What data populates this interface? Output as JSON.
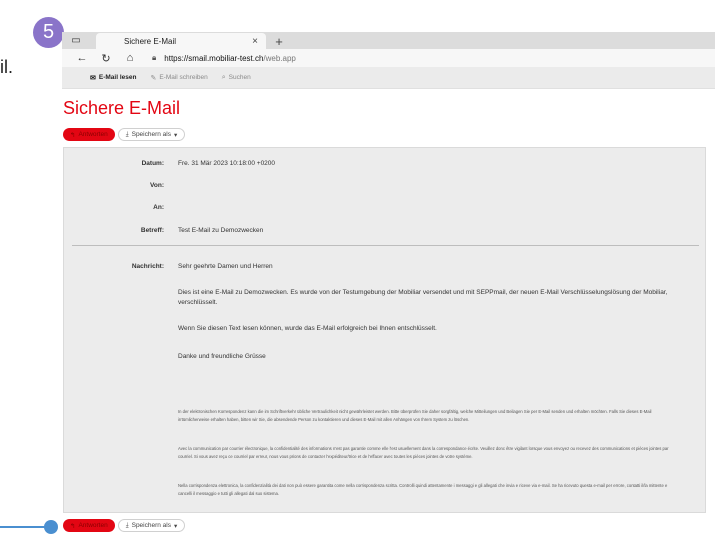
{
  "step_number": "5",
  "stray_text": "il.",
  "browser": {
    "tab_title": "Sichere E-Mail",
    "tab_close": "×",
    "new_tab": "+",
    "url_host": "https://smail.mobiliar-test.ch",
    "url_path": "/web.app"
  },
  "app_nav": {
    "items": [
      {
        "label": "E-Mail lesen",
        "icon": "envelope-icon",
        "active": true
      },
      {
        "label": "E-Mail schreiben",
        "icon": "pencil-icon",
        "active": false
      },
      {
        "label": "Suchen",
        "icon": "search-icon",
        "active": false
      }
    ]
  },
  "page_title": "Sichere E-Mail",
  "actions": {
    "reply_label": "Antworten",
    "save_label": "Speichern als",
    "save_caret": "▾"
  },
  "mail": {
    "date_label": "Datum:",
    "date_value": "Fre. 31 Mär 2023 10:18:00 +0200",
    "from_label": "Von:",
    "to_label": "An:",
    "subject_label": "Betreff:",
    "subject_value": "Test E-Mail zu Demozwecken",
    "message_label": "Nachricht:",
    "greeting": "Sehr geehrte Damen und Herren",
    "paragraph1": "Dies ist eine E-Mail zu Demozwecken. Es wurde von der Testumgebung der Mobiliar versendet und mit SEPPmail, der neuen E-Mail Verschlüsselungslösung der Mobiliar, verschlüsselt.",
    "paragraph2": "Wenn Sie diesen Text lesen können, wurde das E-Mail erfolgreich bei Ihnen entschlüsselt.",
    "closing": "Danke und freundliche Grüsse",
    "disclaimer_de": "In der elektronischen Korrespondenz kann die im Schriftverkehr übliche Vertraulichkeit nicht gewährleistet werden. Bitte überprüfen Sie daher sorgfältig, welche Mitteilungen und Beilagen Sie per E-Mail senden und erhalten möchten. Falls Sie dieses E-Mail irrtümlicherweise erhalten haben, bitten wir Sie, die absendende Person zu kontaktieren und dieses E-Mail mit allen Anhängen von Ihrem System zu löschen.",
    "disclaimer_fr": "Avec la communication par courrier électronique, la confidentialité des informations n'est pas garantie comme elle l'est usuellement dans la correspondance écrite. Veuillez donc être vigilant lorsque vous envoyez ou recevez des communications et pièces jointes par courriel. Si vous avez reçu ce courriel par erreur, nous vous prions de contacter l'expéditeur/trice et de l'effacer avec toutes les pièces jointes de votre système.",
    "disclaimer_it": "Nella corrispondenza elettronica, la confidenzialità dei dati non può essere garantita come nella corrispondenza scritta. Controlli quindi attentamente i messaggi e gli allegati che invia e riceve via e-mail. Se ha ricevuto questa e-mail per errore, contatti il/la mittente e cancelli il messaggio e tutti gli allegati dal suo sistema."
  },
  "colors": {
    "brand_red": "#e30613",
    "callout_blue": "#4a8fd0",
    "step_badge": "#8a74c9"
  }
}
